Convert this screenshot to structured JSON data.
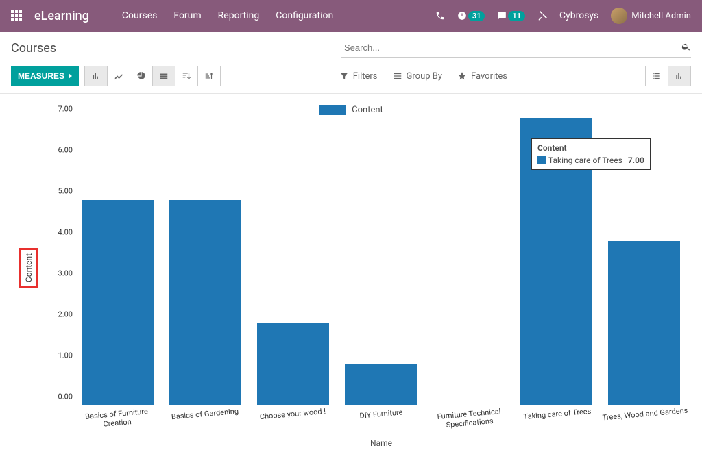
{
  "header": {
    "brand": "eLearning",
    "nav": [
      "Courses",
      "Forum",
      "Reporting",
      "Configuration"
    ],
    "badges": {
      "activities": "31",
      "messages": "11"
    },
    "company": "Cybrosys",
    "user": "Mitchell Admin"
  },
  "cp": {
    "title": "Courses",
    "search_placeholder": "Search...",
    "measures_label": "MEASURES",
    "filter_labels": {
      "filters": "Filters",
      "group_by": "Group By",
      "favorites": "Favorites"
    }
  },
  "chart_data": {
    "type": "bar",
    "categories": [
      "Basics of Furniture Creation",
      "Basics of Gardening",
      "Choose your wood !",
      "DIY Furniture",
      "Furniture Technical Specifications",
      "Taking care of Trees",
      "Trees, Wood and Gardens"
    ],
    "values": [
      5.0,
      5.0,
      2.0,
      1.0,
      0.0,
      7.0,
      4.0
    ],
    "title": "",
    "xlabel": "Name",
    "ylabel": "Content",
    "ylim": [
      0,
      7
    ],
    "legend": "Content",
    "y_ticks": [
      "0.00",
      "1.00",
      "2.00",
      "3.00",
      "4.00",
      "5.00",
      "6.00",
      "7.00"
    ],
    "tooltip": {
      "title": "Content",
      "series_label": "Taking care of Trees",
      "value": "7.00"
    }
  }
}
